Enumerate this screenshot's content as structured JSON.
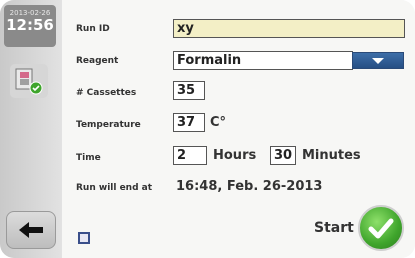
{
  "clock": {
    "date": "2013-02-26",
    "time": "12:56"
  },
  "form": {
    "run_id_label": "Run ID",
    "run_id_value": "xy",
    "reagent_label": "Reagent",
    "reagent_value": "Formalin",
    "cassettes_label": "# Cassettes",
    "cassettes_value": "35",
    "temperature_label": "Temperature",
    "temperature_value": "37",
    "temperature_unit": "C°",
    "time_label": "Time",
    "hours_value": "2",
    "hours_unit": "Hours",
    "minutes_value": "30",
    "minutes_unit": "Minutes",
    "end_label": "Run will end at",
    "end_value": "16:48, Feb. 26-2013"
  },
  "actions": {
    "start_label": "Start"
  },
  "colors": {
    "accent_green": "#3fa52c",
    "dropdown_blue": "#2f5f97",
    "run_id_bg": "#f3efc6"
  },
  "icons": {
    "rack": "cassette-rack-icon",
    "back": "arrow-left-icon",
    "start": "checkmark-icon",
    "dropdown": "chevron-down-icon",
    "checkbox": "checkbox-icon"
  }
}
